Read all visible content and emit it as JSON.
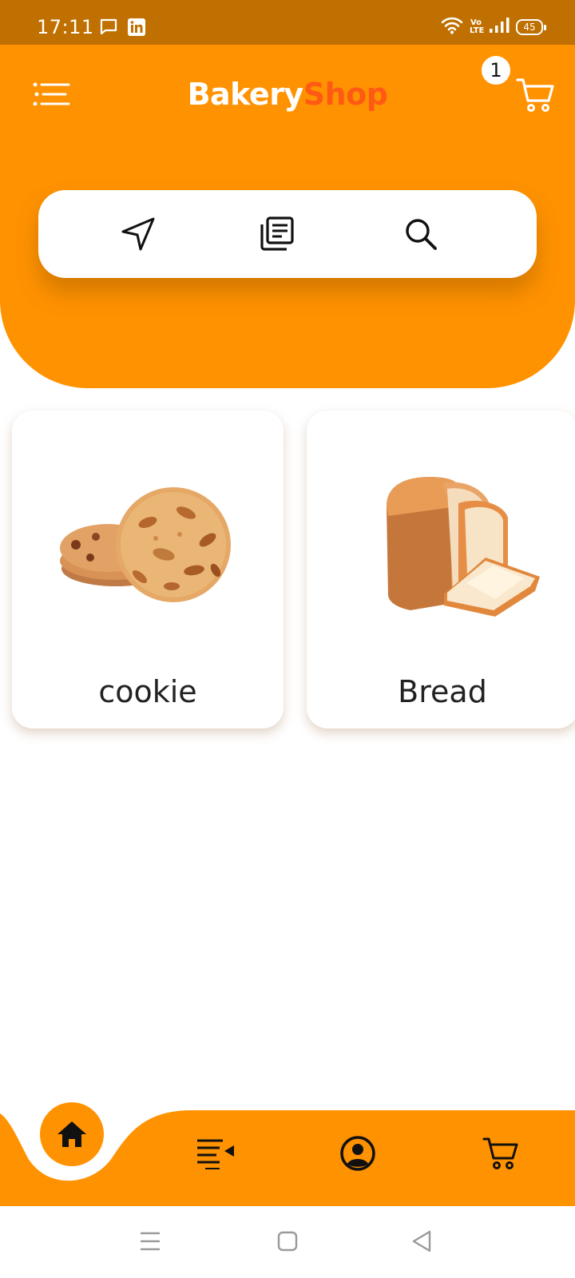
{
  "status_bar": {
    "time": "17:11",
    "icons": [
      "message-icon",
      "linkedin-icon",
      "wifi-icon",
      "volte-icon",
      "signal-icon",
      "battery-icon"
    ],
    "volte_label": "Vo LTE",
    "battery_level": "45"
  },
  "header": {
    "brand_part1": "Bakery",
    "brand_part2": "Shop",
    "cart_count": "1",
    "menu_icon": "menu-icon",
    "cart_icon": "cart-icon"
  },
  "search_card": {
    "items": [
      {
        "name": "location-button",
        "icon": "navigation-arrow-icon"
      },
      {
        "name": "catalog-button",
        "icon": "document-list-icon"
      },
      {
        "name": "search-button",
        "icon": "search-icon"
      }
    ]
  },
  "products": [
    {
      "label": "cookie",
      "image": "cookies-image"
    },
    {
      "label": "Bread",
      "image": "bread-loaf-image"
    }
  ],
  "bottom_nav": {
    "items": [
      {
        "name": "home",
        "icon": "home-icon",
        "active": true
      },
      {
        "name": "playlist",
        "icon": "playlist-icon",
        "active": false
      },
      {
        "name": "profile",
        "icon": "account-circle-icon",
        "active": false
      },
      {
        "name": "cart",
        "icon": "cart-icon",
        "active": false
      }
    ]
  },
  "system_nav": {
    "items": [
      "recents-icon",
      "home-square-icon",
      "back-triangle-icon"
    ]
  },
  "colors": {
    "status_bar": "#bf7000",
    "primary": "#ff9200",
    "brand_accent": "#ff5a14",
    "text_dark": "#222222",
    "surface": "#ffffff"
  }
}
